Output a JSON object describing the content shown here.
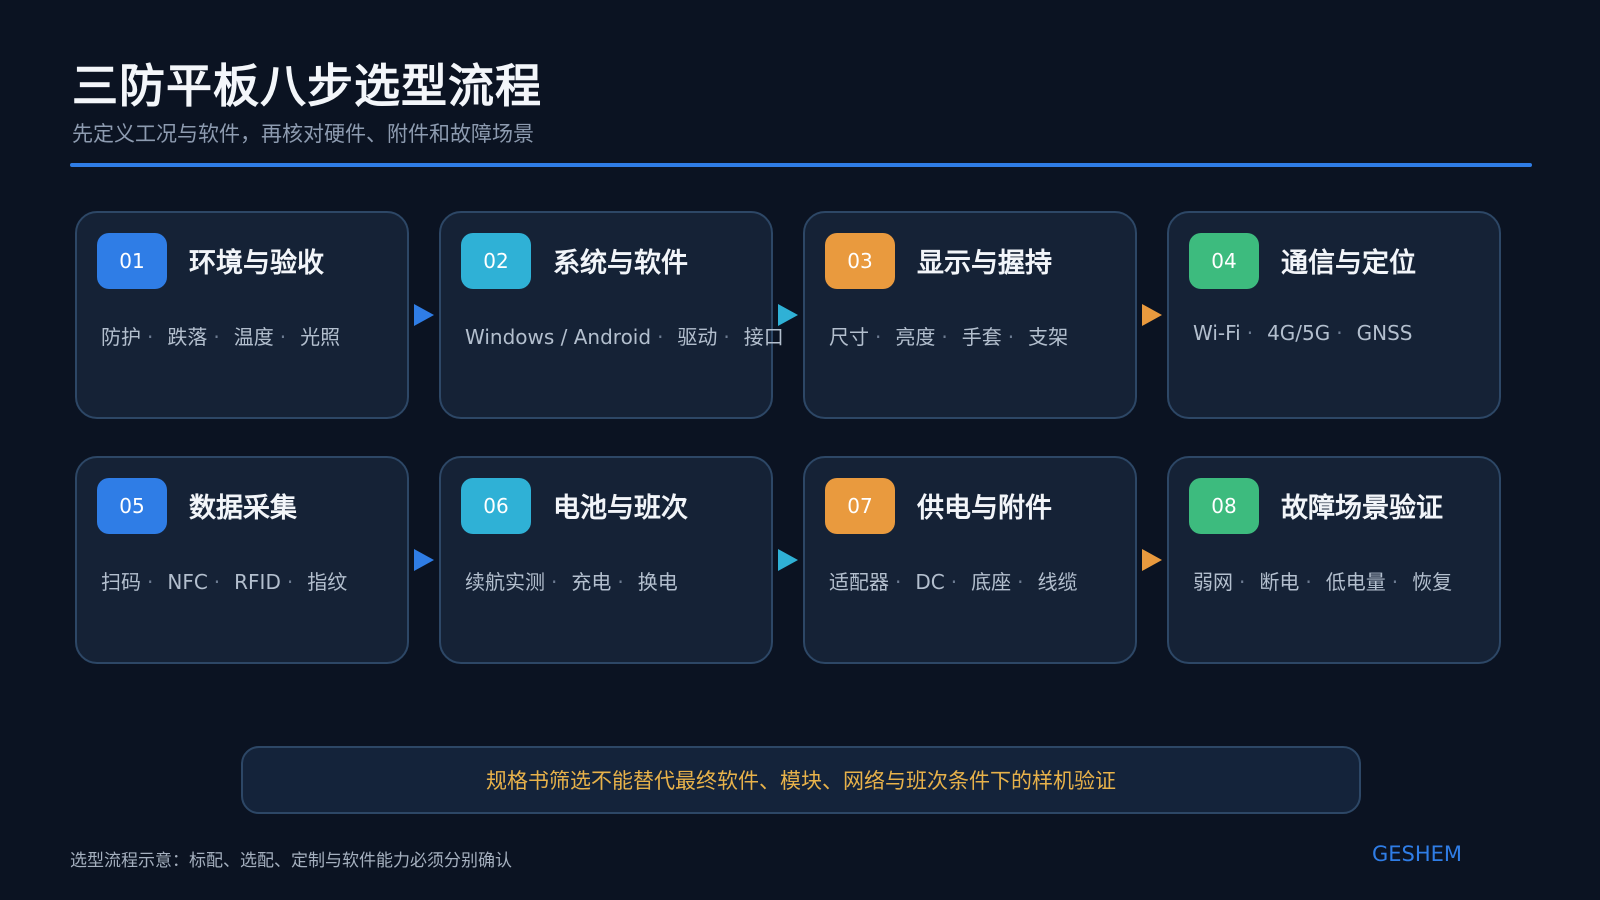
{
  "header": {
    "title": "三防平板八步选型流程",
    "subtitle": "先定义工况与软件，再核对硬件、附件和故障场景"
  },
  "steps": [
    {
      "number": "01",
      "title": "环境与验收",
      "color": "#2f7de6",
      "tags": [
        "防护",
        "跌落",
        "温度",
        "光照"
      ]
    },
    {
      "number": "02",
      "title": "系统与软件",
      "color": "#2fb1d6",
      "tags": [
        "Windows / Android",
        "驱动",
        "接口"
      ]
    },
    {
      "number": "03",
      "title": "显示与握持",
      "color": "#e99a3e",
      "tags": [
        "尺寸",
        "亮度",
        "手套",
        "支架"
      ]
    },
    {
      "number": "04",
      "title": "通信与定位",
      "color": "#3dbb7e",
      "tags": [
        "Wi-Fi",
        "4G/5G",
        "GNSS"
      ]
    },
    {
      "number": "05",
      "title": "数据采集",
      "color": "#2f7de6",
      "tags": [
        "扫码",
        "NFC",
        "RFID",
        "指纹"
      ]
    },
    {
      "number": "06",
      "title": "电池与班次",
      "color": "#2fb1d6",
      "tags": [
        "续航实测",
        "充电",
        "换电"
      ]
    },
    {
      "number": "07",
      "title": "供电与附件",
      "color": "#e99a3e",
      "tags": [
        "适配器",
        "DC",
        "底座",
        "线缆"
      ]
    },
    {
      "number": "08",
      "title": "故障场景验证",
      "color": "#3dbb7e",
      "tags": [
        "弱网",
        "断电",
        "低电量",
        "恢复"
      ]
    }
  ],
  "arrow_colors": [
    "#2f7de6",
    "#2fb1d6",
    "#e99a3e",
    "#2f7de6",
    "#2fb1d6",
    "#e99a3e"
  ],
  "note": "规格书筛选不能替代最终软件、模块、网络与班次条件下的样机验证",
  "footer": {
    "note": "选型流程示意：标配、选配、定制与软件能力必须分别确认",
    "brand": "GESHEM"
  }
}
